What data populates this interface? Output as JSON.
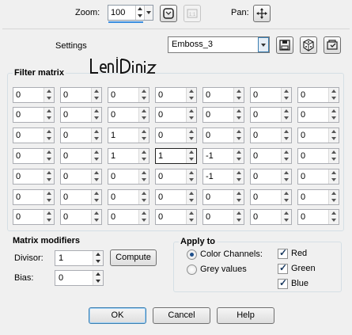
{
  "toolbar": {
    "zoom_label": "Zoom:",
    "zoom_value": "100",
    "pan_label": "Pan:"
  },
  "settings": {
    "label": "Settings",
    "preset_value": "Emboss_3"
  },
  "filter_matrix": {
    "title": "Filter matrix",
    "watermark_text": "LeniDiniz",
    "rows": [
      [
        "0",
        "0",
        "0",
        "0",
        "0",
        "0",
        "0"
      ],
      [
        "0",
        "0",
        "0",
        "0",
        "0",
        "0",
        "0"
      ],
      [
        "0",
        "0",
        "1",
        "0",
        "0",
        "0",
        "0"
      ],
      [
        "0",
        "0",
        "1",
        "1",
        "-1",
        "0",
        "0"
      ],
      [
        "0",
        "0",
        "0",
        "0",
        "-1",
        "0",
        "0"
      ],
      [
        "0",
        "0",
        "0",
        "0",
        "0",
        "0",
        "0"
      ],
      [
        "0",
        "0",
        "0",
        "0",
        "0",
        "0",
        "0"
      ]
    ],
    "focused_cell": [
      3,
      3
    ]
  },
  "matrix_modifiers": {
    "title": "Matrix modifiers",
    "divisor_label": "Divisor:",
    "divisor_value": "1",
    "compute_label": "Compute",
    "bias_label": "Bias:",
    "bias_value": "0"
  },
  "apply_to": {
    "title": "Apply to",
    "color_channels_label": "Color Channels:",
    "grey_values_label": "Grey values",
    "selected": "color_channels",
    "red_label": "Red",
    "green_label": "Green",
    "blue_label": "Blue",
    "red_checked": true,
    "green_checked": true,
    "blue_checked": true
  },
  "buttons": {
    "ok": "OK",
    "cancel": "Cancel",
    "help": "Help"
  },
  "colors": {
    "accent": "#3c7fb1",
    "background": "#f0f0f0"
  }
}
